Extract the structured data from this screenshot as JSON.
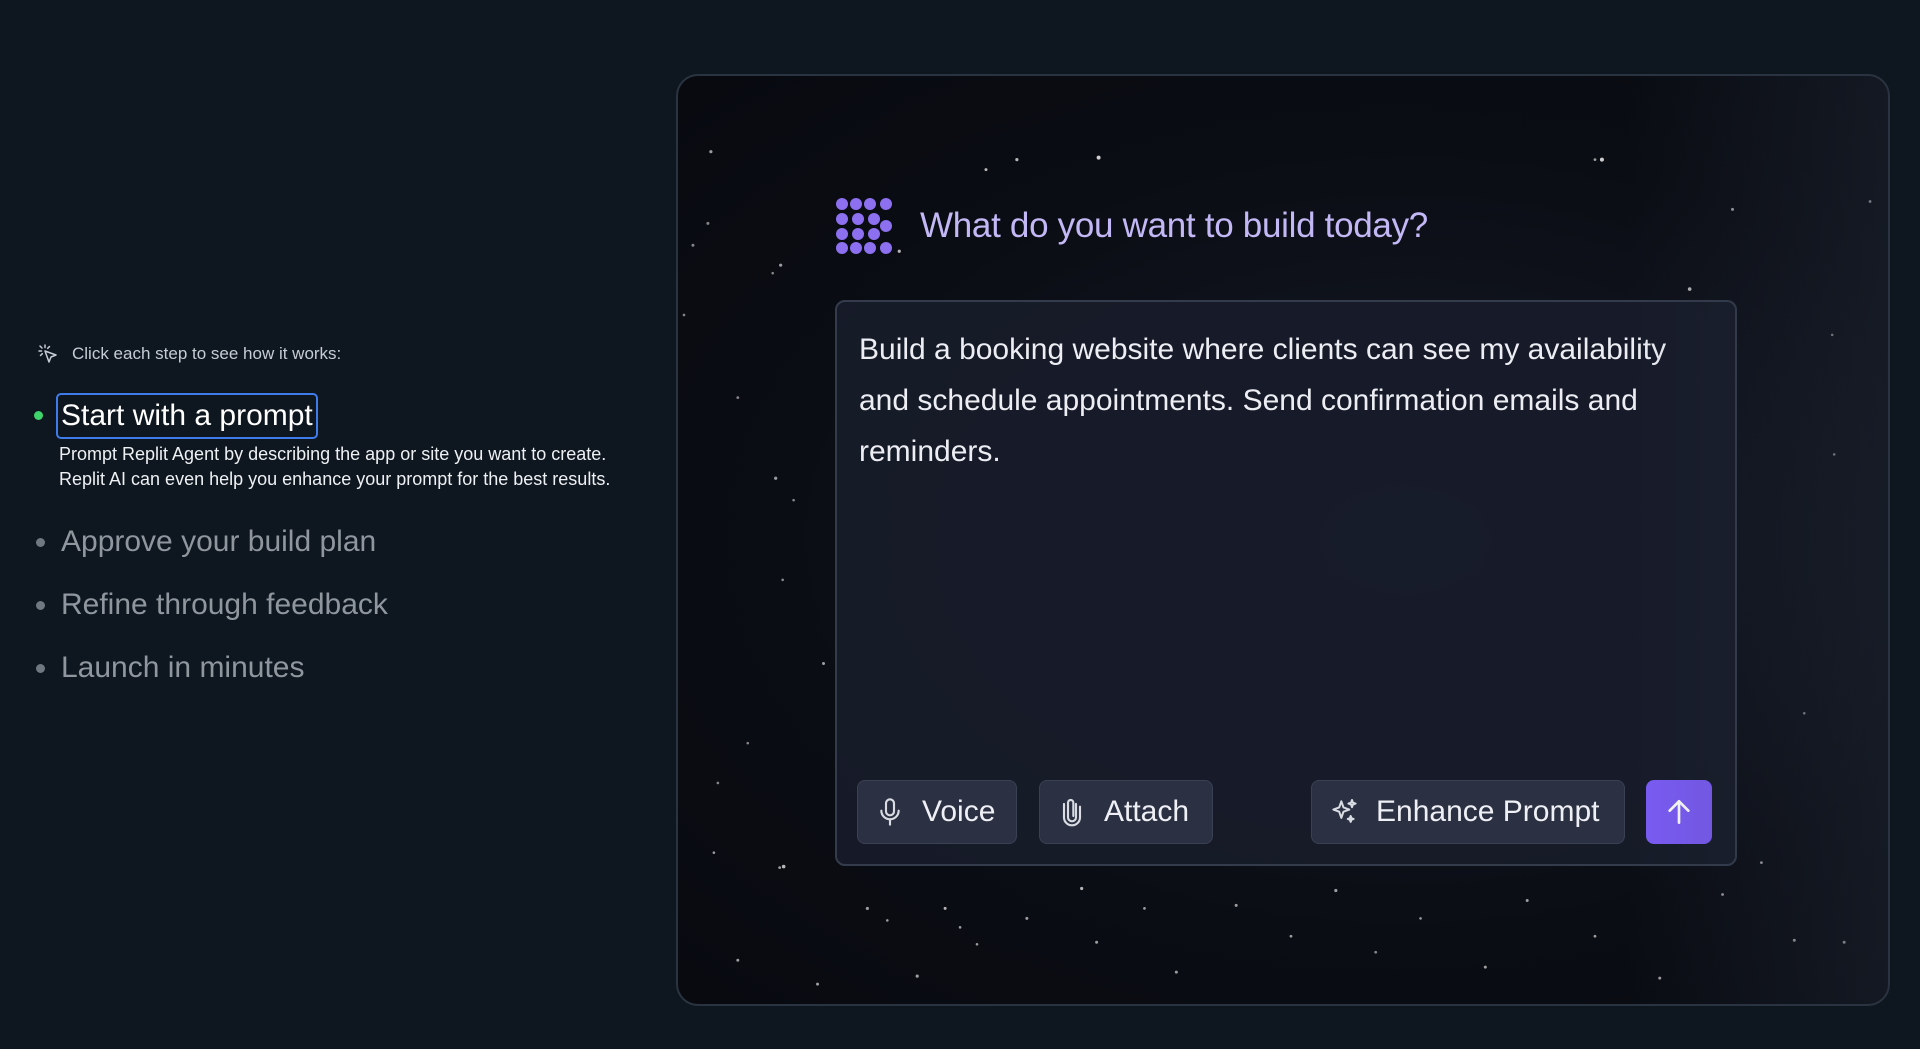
{
  "left": {
    "hint": "Click each step to see how it works:",
    "steps": [
      {
        "title": "Start with a prompt",
        "description": "Prompt Replit Agent by describing the app or site you want to create. Replit AI can even help you enhance your prompt for the best results.",
        "active": true
      },
      {
        "title": "Approve your build plan",
        "active": false
      },
      {
        "title": "Refine through feedback",
        "active": false
      },
      {
        "title": "Launch in minutes",
        "active": false
      }
    ]
  },
  "panel": {
    "heading": "What do you want to build today?",
    "prompt_text": "Build a booking website where clients can see my availability and schedule appointments. Send confirmation emails and reminders.",
    "buttons": {
      "voice": "Voice",
      "attach": "Attach",
      "enhance": "Enhance Prompt",
      "send_icon": "arrow-up-icon"
    }
  },
  "colors": {
    "background": "#0e161f",
    "accent_purple": "#7b5cf5",
    "heading_lilac": "#c3b8f6",
    "active_bullet": "#3fd36b",
    "focus_outline": "#3f7bea"
  }
}
